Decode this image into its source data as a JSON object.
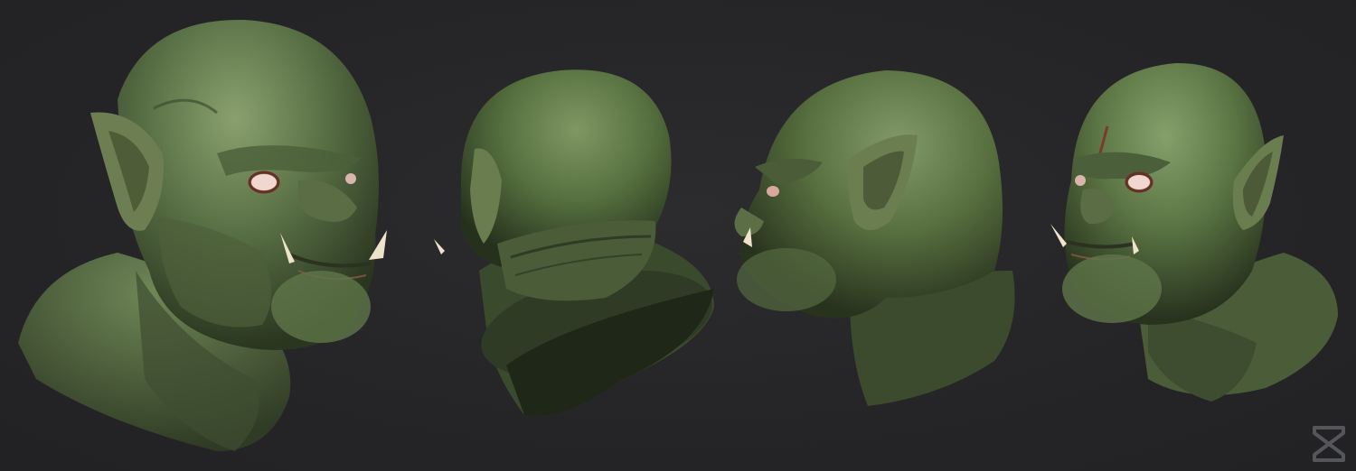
{
  "scene": {
    "background_color": "#252527",
    "skin_color": "#5c7448",
    "skin_shadow_color": "#2a3620",
    "skin_highlight_color": "#8aa06e",
    "tusk_color": "#efe3cc",
    "eye_color": "#f0d8d0",
    "views": [
      {
        "angle": "three-quarter-left"
      },
      {
        "angle": "rear"
      },
      {
        "angle": "profile-left"
      },
      {
        "angle": "three-quarter-right"
      }
    ]
  },
  "logo": {
    "icon": "studio-logo-icon",
    "color": "#55565a"
  }
}
